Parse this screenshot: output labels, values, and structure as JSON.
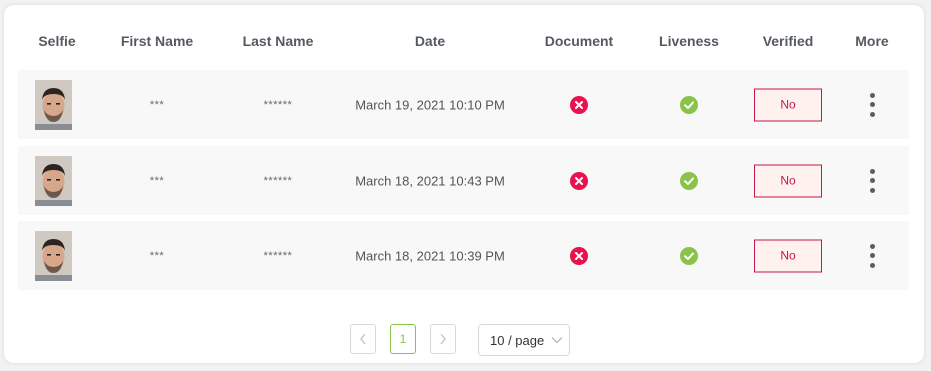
{
  "table": {
    "columns": {
      "selfie": "Selfie",
      "first_name": "First Name",
      "last_name": "Last Name",
      "date": "Date",
      "document": "Document",
      "liveness": "Liveness",
      "verified": "Verified",
      "more": "More"
    },
    "rows": [
      {
        "first_name": "***",
        "last_name": "******",
        "date": "March 19, 2021 10:10 PM",
        "document": "failed",
        "liveness": "passed",
        "verified": "No"
      },
      {
        "first_name": "***",
        "last_name": "******",
        "date": "March 18, 2021 10:43 PM",
        "document": "failed",
        "liveness": "passed",
        "verified": "No"
      },
      {
        "first_name": "***",
        "last_name": "******",
        "date": "March 18, 2021 10:39 PM",
        "document": "failed",
        "liveness": "passed",
        "verified": "No"
      }
    ]
  },
  "pagination": {
    "current_page": "1",
    "page_size": "10 / page"
  },
  "colors": {
    "fail": "#e8124e",
    "pass": "#8bc34a",
    "verified_border": "#c4174f",
    "verified_bg": "#fff1ed",
    "row_bg": "#f8f8f8"
  },
  "icons": {
    "fail": "x-circle-icon",
    "pass": "check-circle-icon",
    "more": "kebab-menu-icon"
  }
}
